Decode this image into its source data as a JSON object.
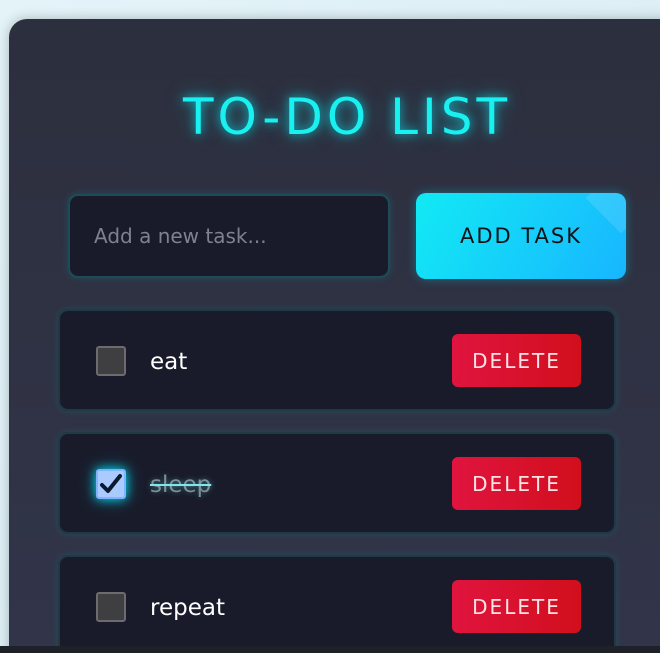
{
  "app": {
    "title": "TO-DO LIST",
    "accent_color": "#19f0f0",
    "delete_color": "#d10f1c"
  },
  "input": {
    "value": "",
    "placeholder": "Add a new task..."
  },
  "add_button": {
    "label": "ADD TASK"
  },
  "tasks": [
    {
      "text": "eat",
      "completed": false,
      "delete_label": "DELETE"
    },
    {
      "text": "sleep",
      "completed": true,
      "delete_label": "DELETE"
    },
    {
      "text": "repeat",
      "completed": false,
      "delete_label": "DELETE"
    }
  ],
  "icons": {
    "check": "checkmark-icon"
  }
}
